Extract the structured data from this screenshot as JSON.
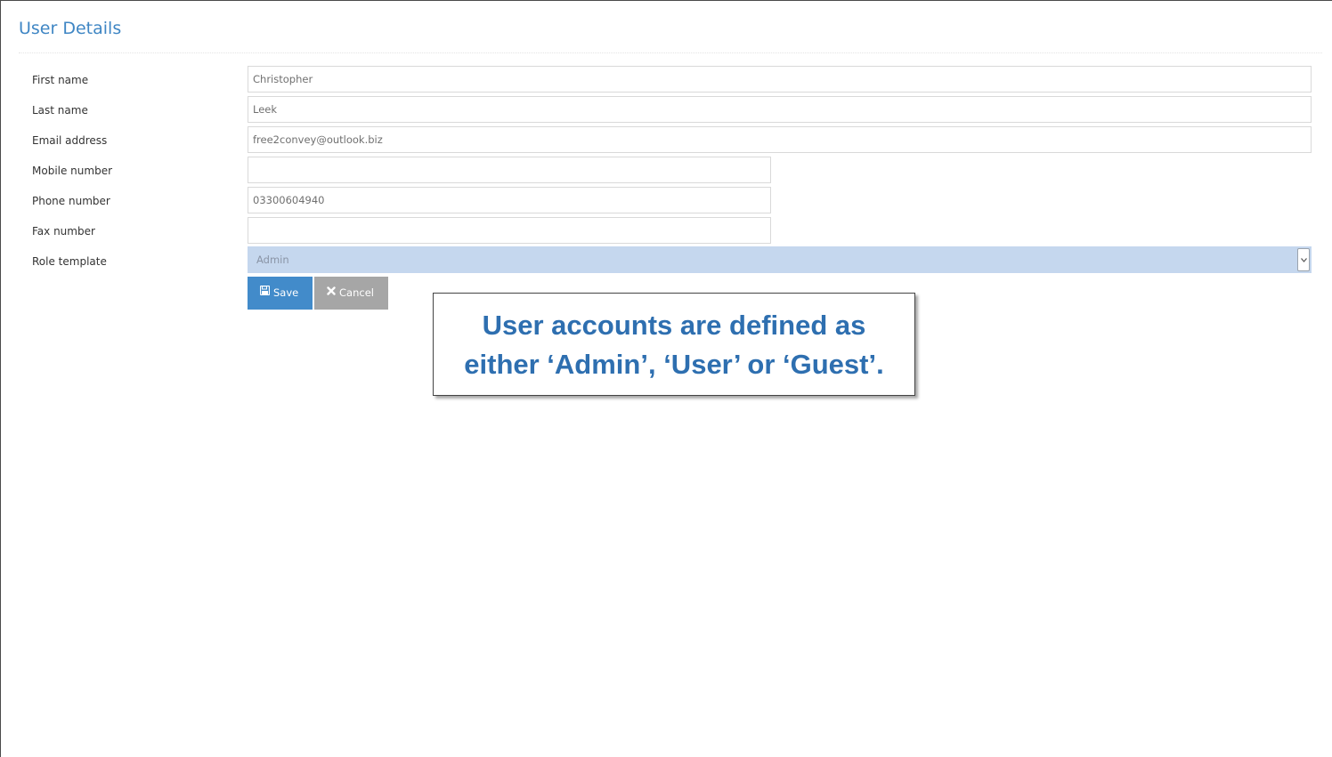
{
  "page": {
    "title": "User Details"
  },
  "form": {
    "first_name": {
      "label": "First name",
      "value": "Christopher"
    },
    "last_name": {
      "label": "Last name",
      "value": "Leek"
    },
    "email": {
      "label": "Email address",
      "value": "free2convey@outlook.biz"
    },
    "mobile": {
      "label": "Mobile number",
      "value": ""
    },
    "phone": {
      "label": "Phone number",
      "value": "03300604940"
    },
    "fax": {
      "label": "Fax number",
      "value": ""
    },
    "role": {
      "label": "Role template",
      "value": "Admin"
    }
  },
  "actions": {
    "save_label": "Save",
    "cancel_label": "Cancel"
  },
  "callout": {
    "line1": "User accounts are defined as",
    "line2": "either ‘Admin’, ‘User’ or ‘Guest’."
  },
  "icons": {
    "save": "floppy-disk-icon",
    "cancel": "close-icon",
    "select": "chevron-down-icon"
  },
  "colors": {
    "title": "#3f86c4",
    "save_button": "#428bca",
    "cancel_button": "#a6a6a6",
    "role_select_bg": "#c5d7ee",
    "callout_text": "#2e6fb0"
  }
}
